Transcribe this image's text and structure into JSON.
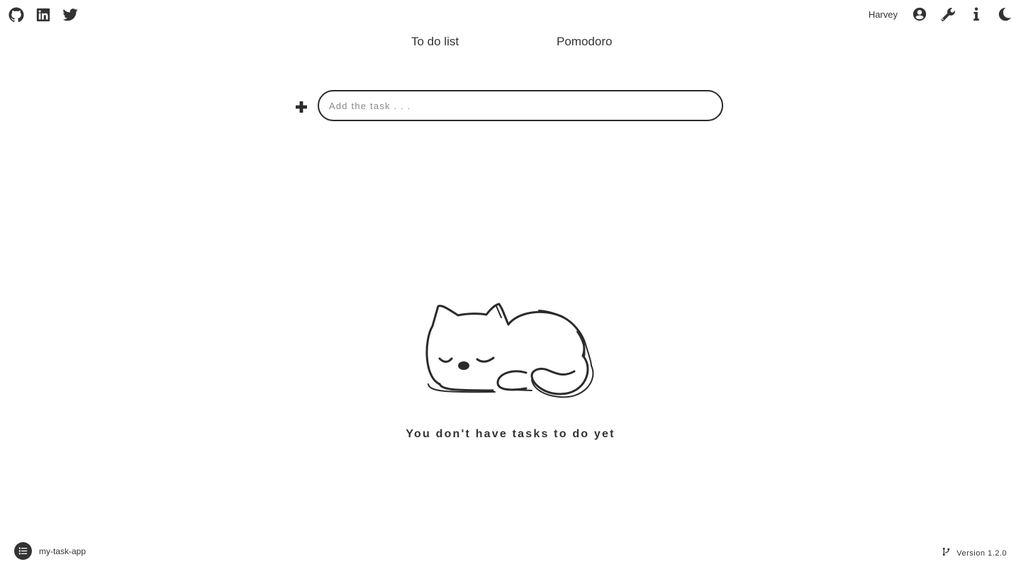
{
  "header": {
    "social_icons": [
      "github-icon",
      "linkedin-icon",
      "twitter-icon"
    ],
    "username": "Harvey",
    "action_icons": [
      "user-circle-icon",
      "wrench-icon",
      "info-icon",
      "moon-icon"
    ]
  },
  "tabs": [
    {
      "label": "To do list"
    },
    {
      "label": "Pomodoro"
    }
  ],
  "task_input": {
    "placeholder": "Add the task . . .",
    "value": ""
  },
  "empty_state": {
    "illustration": "sleeping-cat",
    "message": "You don't have tasks to do yet"
  },
  "footer": {
    "app_name": "my-task-app",
    "app_icon": "task-list-icon",
    "version_icon": "code-branch-icon",
    "version": "Version 1.2.0"
  },
  "colors": {
    "text": "#2b2b2b",
    "background": "#ffffff",
    "placeholder": "#8a8a8a"
  }
}
